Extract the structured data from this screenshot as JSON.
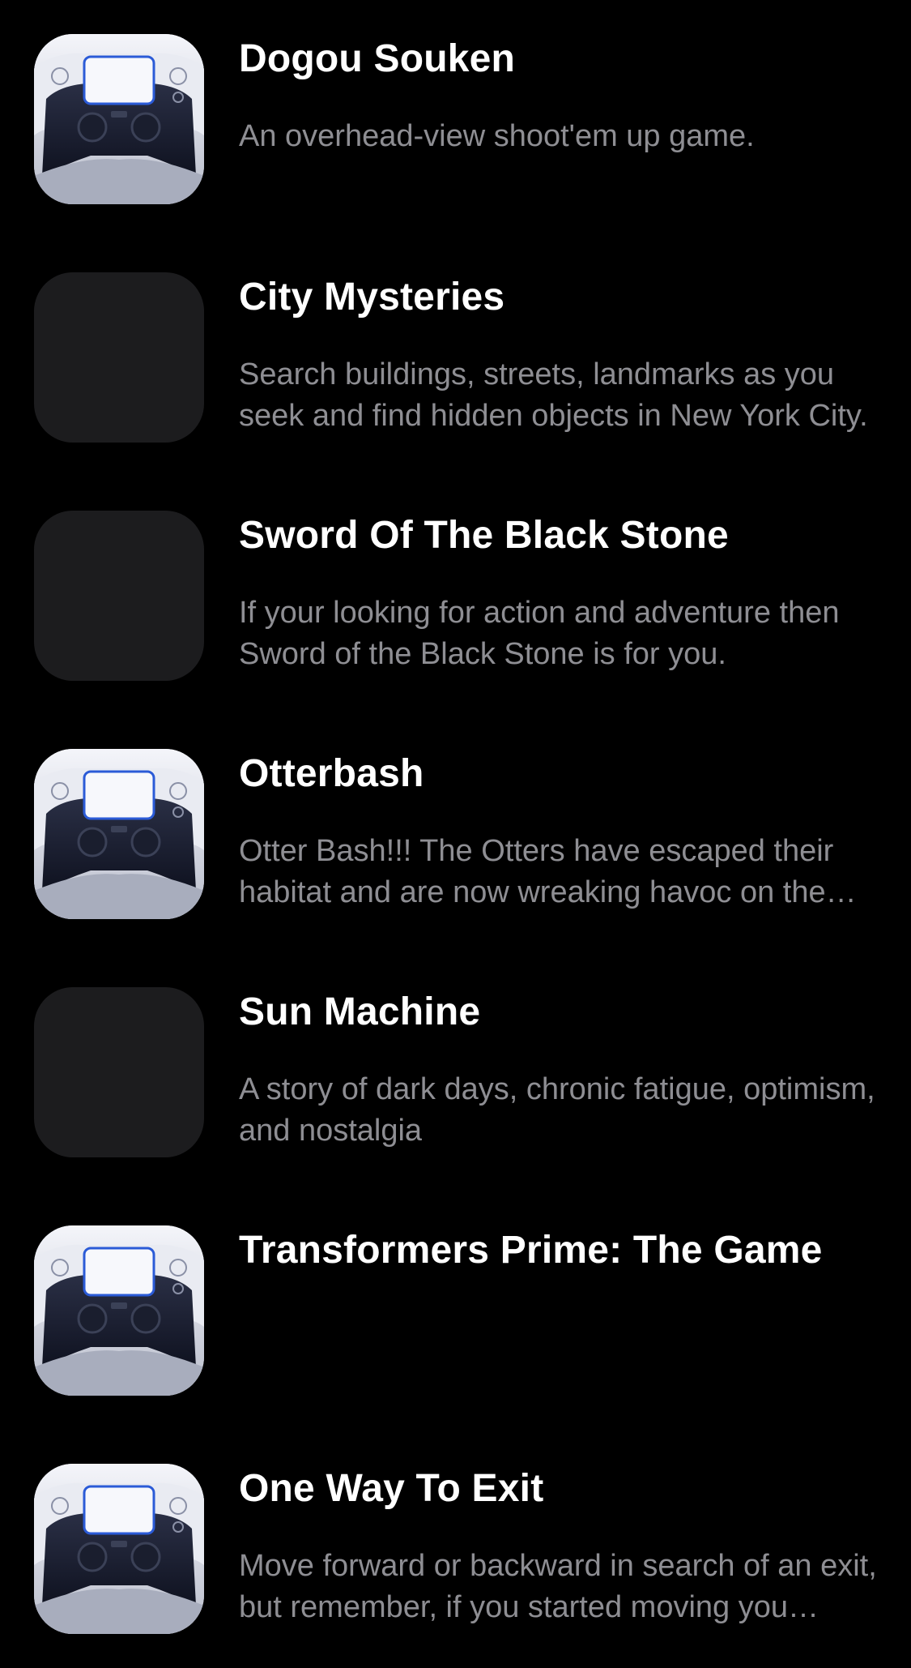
{
  "games": [
    {
      "title": "Dogou Souken",
      "description": "An overhead-view shoot'em up game.",
      "thumbnail_icon": "controller-icon"
    },
    {
      "title": "City Mysteries",
      "description": "Search buildings, streets, landmarks as you seek and find hidden objects in New York City.",
      "thumbnail_icon": "placeholder"
    },
    {
      "title": "Sword Of The Black Stone",
      "description": "If your looking for action and adventure then Sword of the Black Stone is for you.",
      "thumbnail_icon": "placeholder"
    },
    {
      "title": "Otterbash",
      "description": "Otter Bash!!! The Otters have escaped their habitat and are now wreaking havoc on the town.",
      "thumbnail_icon": "controller-icon"
    },
    {
      "title": "Sun Machine",
      "description": "A story of dark days, chronic fatigue, optimism, and nostalgia",
      "thumbnail_icon": "placeholder"
    },
    {
      "title": "Transformers Prime: The Game",
      "description": "",
      "thumbnail_icon": "controller-icon"
    },
    {
      "title": "One Way To Exit",
      "description": "Move forward or backward in search of an exit, but remember, if you started moving you cannot stop.",
      "thumbnail_icon": "controller-icon"
    }
  ],
  "colors": {
    "background": "#000000",
    "title": "#ffffff",
    "description": "#8e8e93",
    "placeholder_tile": "#1c1c1e",
    "controller_accent": "#2b5bd7"
  }
}
